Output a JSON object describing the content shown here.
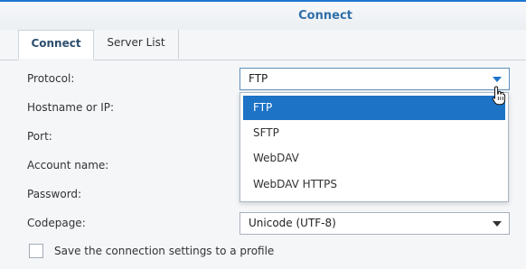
{
  "window": {
    "title": "Connect"
  },
  "tabs": [
    {
      "label": "Connect",
      "active": true
    },
    {
      "label": "Server List",
      "active": false
    }
  ],
  "form": {
    "protocol_label": "Protocol:",
    "protocol_value": "FTP",
    "hostname_label": "Hostname or IP:",
    "port_label": "Port:",
    "account_label": "Account name:",
    "password_label": "Password:",
    "codepage_label": "Codepage:",
    "codepage_value": "Unicode (UTF-8)",
    "save_profile_label": "Save the connection settings to a profile",
    "save_profile_checked": false
  },
  "protocol_dropdown": {
    "options": [
      "FTP",
      "SFTP",
      "WebDAV",
      "WebDAV HTTPS"
    ],
    "selected": "FTP"
  },
  "colors": {
    "accent": "#1d73c5",
    "title": "#2f6fa8"
  },
  "icons": {
    "dropdown_arrow": "triangle-down-icon",
    "cursor": "hand-pointer-icon"
  }
}
